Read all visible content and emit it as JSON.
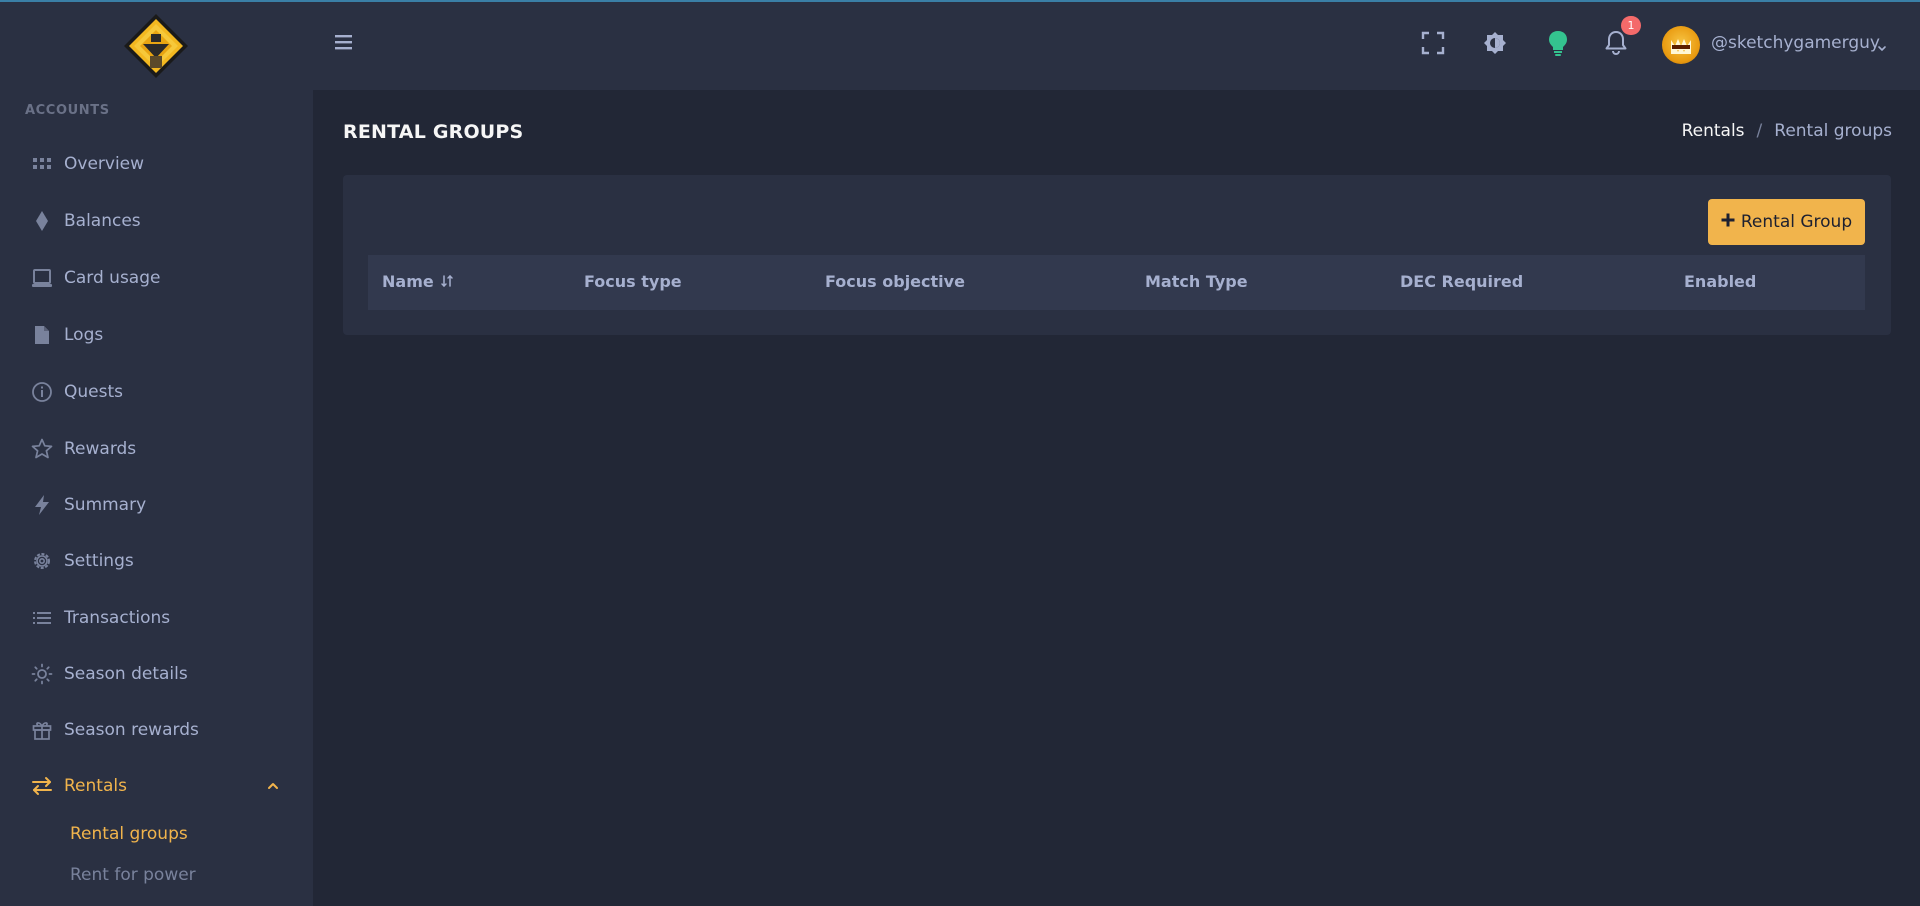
{
  "sidebar": {
    "section_title": "ACCOUNTS",
    "items": [
      {
        "label": "Overview",
        "icon": "grid-icon"
      },
      {
        "label": "Balances",
        "icon": "diamond-icon"
      },
      {
        "label": "Card usage",
        "icon": "laptop-icon"
      },
      {
        "label": "Logs",
        "icon": "file-icon"
      },
      {
        "label": "Quests",
        "icon": "info-icon"
      },
      {
        "label": "Rewards",
        "icon": "star-icon"
      },
      {
        "label": "Summary",
        "icon": "bolt-icon"
      },
      {
        "label": "Settings",
        "icon": "gear-icon"
      },
      {
        "label": "Transactions",
        "icon": "list-icon"
      },
      {
        "label": "Season details",
        "icon": "sun-icon"
      },
      {
        "label": "Season rewards",
        "icon": "gift-icon"
      },
      {
        "label": "Rentals",
        "icon": "swap-icon",
        "expanded": true
      }
    ],
    "submenu": [
      {
        "label": "Rental groups",
        "active": true
      },
      {
        "label": "Rent for power",
        "active": false
      }
    ]
  },
  "header": {
    "notification_count": "1",
    "username": "@sketchygamerguy"
  },
  "page": {
    "title": "RENTAL GROUPS",
    "breadcrumb": {
      "parent": "Rentals",
      "separator": "/",
      "current": "Rental groups"
    }
  },
  "toolbar": {
    "add_button_label": "Rental Group"
  },
  "table": {
    "columns": [
      "Name",
      "Focus type",
      "Focus objective",
      "Match Type",
      "DEC Required",
      "Enabled"
    ]
  },
  "colors": {
    "accent": "#f1b44c",
    "sidebar_bg": "#2a3042",
    "page_bg": "#222736",
    "badge": "#f46a6a",
    "lightbulb": "#34c38f"
  }
}
